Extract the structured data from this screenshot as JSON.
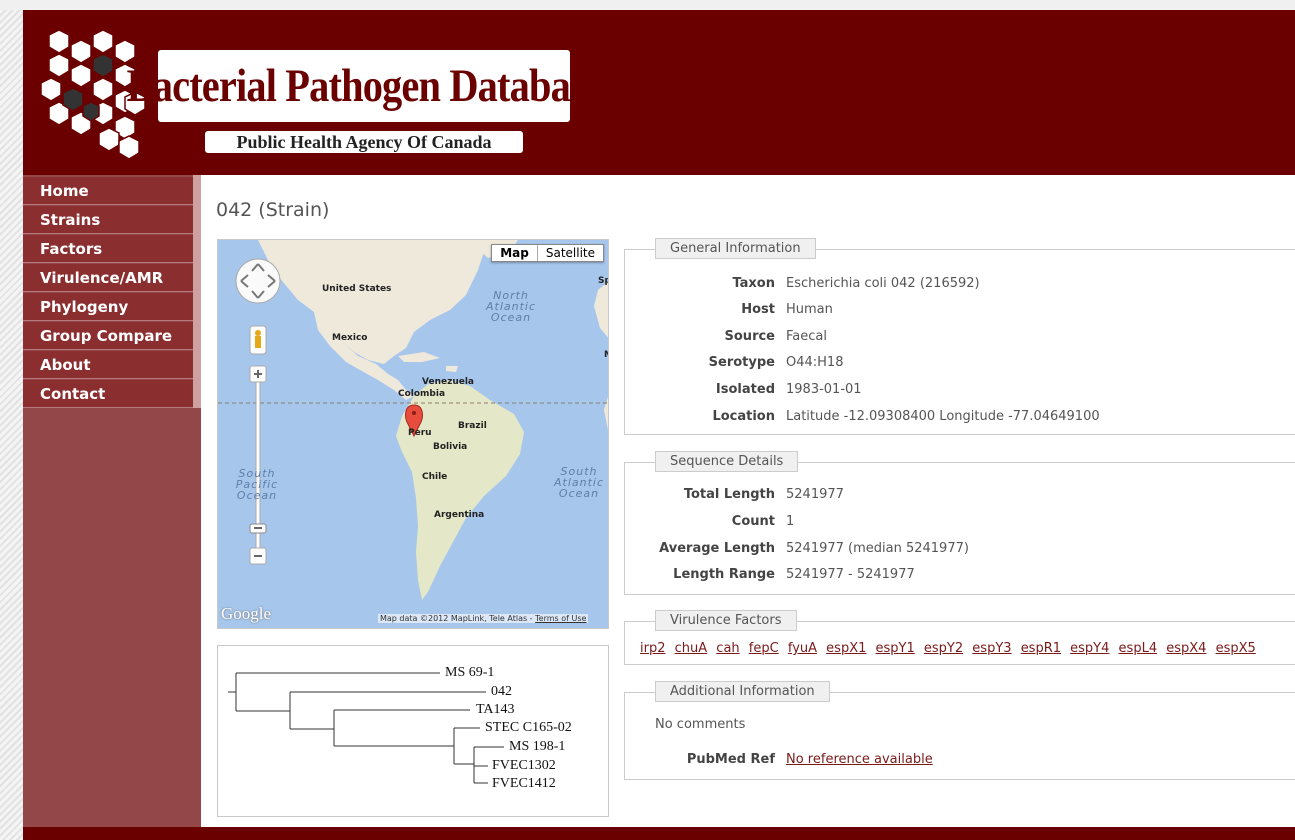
{
  "header": {
    "title": "Bacterial Pathogen Database",
    "subtitle": "Public Health Agency Of Canada"
  },
  "nav": {
    "items": [
      {
        "label": "Home"
      },
      {
        "label": "Strains"
      },
      {
        "label": "Factors"
      },
      {
        "label": "Virulence/AMR"
      },
      {
        "label": "Phylogeny"
      },
      {
        "label": "Group Compare"
      },
      {
        "label": "About"
      },
      {
        "label": "Contact"
      }
    ]
  },
  "page": {
    "title": "042 (Strain)"
  },
  "map": {
    "type_buttons": [
      "Map",
      "Satellite"
    ],
    "labels": {
      "us": "United States",
      "mexico": "Mexico",
      "venezuela": "Venezuela",
      "colombia": "Colombia",
      "brazil": "Brazil",
      "peru": "Peru",
      "bolivia": "Bolivia",
      "chile": "Chile",
      "argentina": "Argentina",
      "sp": "Sp",
      "m": "M",
      "n_atlantic": "North Atlantic Ocean",
      "s_pacific": "South Pacific Ocean",
      "s_atlantic": "South Atlantic Ocean"
    },
    "google": "Google",
    "attribution": "Map data ©2012 MapLink, Tele Atlas - ",
    "terms": "Terms of Use"
  },
  "tree": {
    "leaves": [
      "MS 69-1",
      "042",
      "TA143",
      "STEC C165-02",
      "MS 198-1",
      "FVEC1302",
      "FVEC1412"
    ]
  },
  "general": {
    "legend": "General Information",
    "rows": [
      {
        "key": "Taxon",
        "value": "Escherichia coli 042 (216592)"
      },
      {
        "key": "Host",
        "value": "Human"
      },
      {
        "key": "Source",
        "value": "Faecal"
      },
      {
        "key": "Serotype",
        "value": "O44:H18"
      },
      {
        "key": "Isolated",
        "value": "1983-01-01"
      },
      {
        "key": "Location",
        "value": "Latitude -12.09308400 Longitude -77.04649100"
      }
    ]
  },
  "sequence": {
    "legend": "Sequence Details",
    "rows": [
      {
        "key": "Total Length",
        "value": "5241977"
      },
      {
        "key": "Count",
        "value": "1"
      },
      {
        "key": "Average Length",
        "value": "5241977 (median 5241977)"
      },
      {
        "key": "Length Range",
        "value": "5241977 - 5241977"
      }
    ]
  },
  "virulence": {
    "legend": "Virulence Factors",
    "factors": [
      "irp2",
      "chuA",
      "cah",
      "fepC",
      "fyuA",
      "espX1",
      "espY1",
      "espY2",
      "espY3",
      "espR1",
      "espY4",
      "espL4",
      "espX4",
      "espX5"
    ]
  },
  "additional": {
    "legend": "Additional Information",
    "comments": "No comments",
    "pubmed_key": "PubMed Ref",
    "pubmed_value": "No reference available"
  },
  "colors": {
    "brand": "#6a0000",
    "sidebar": "#944749",
    "menu_item": "#8b2e30",
    "link": "#7a1a1a"
  }
}
